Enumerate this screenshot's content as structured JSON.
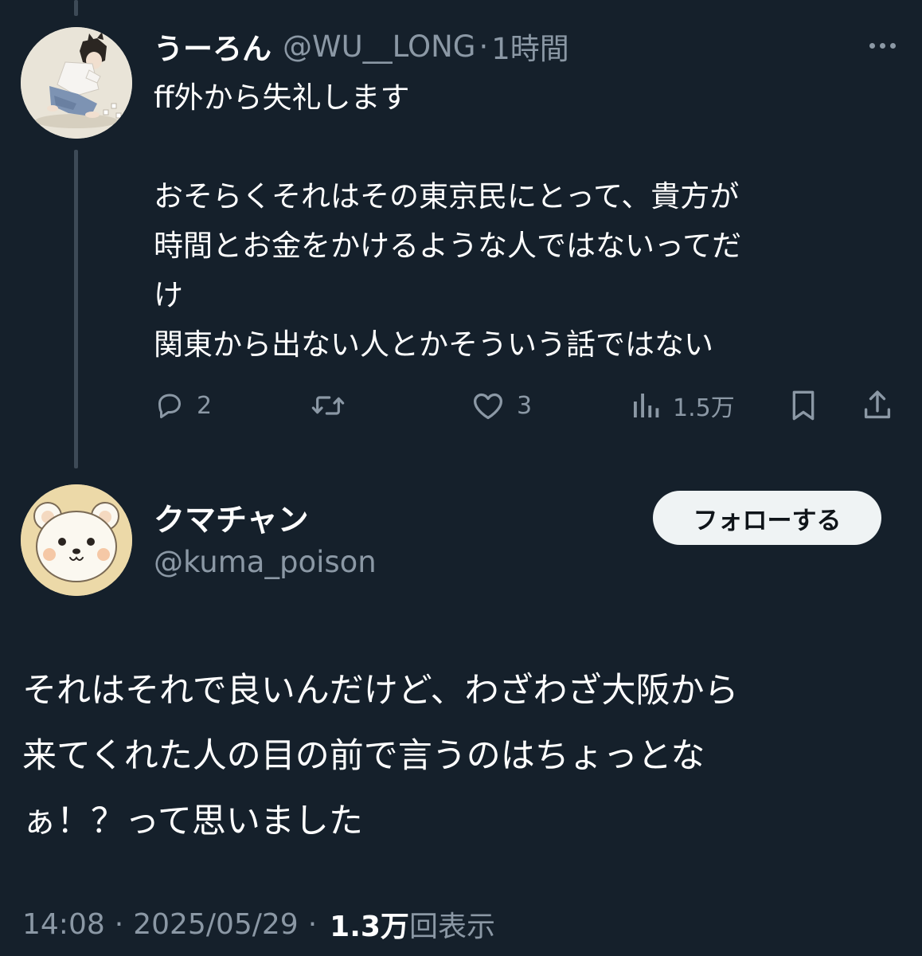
{
  "tweet1": {
    "display_name": "うーろん",
    "handle": "@WU__LONG",
    "separator": "·",
    "time": "1時間",
    "more_icon": "more-horizontal-icon",
    "lines": [
      "ff外から失礼します",
      "",
      "おそらくそれはその東京民にとって、貴方が",
      "時間とお金をかけるような人ではないってだ",
      "け",
      "関東から出ない人とかそういう話ではない"
    ],
    "actions": {
      "reply_count": "2",
      "retweet_count": "",
      "like_count": "3",
      "views_count": "1.5万"
    }
  },
  "tweet2": {
    "display_name": "クマチャン",
    "handle": "@kuma_poison",
    "follow_label": "フォローする",
    "lines": [
      "それはそれで良いんだけど、わざわざ大阪から",
      "来てくれた人の目の前で言うのはちょっとな",
      "ぁ！？って思いました"
    ],
    "time": "14:08",
    "separator": "·",
    "date": "2025/05/29",
    "views_count": "1.3万",
    "views_label": "回表示"
  },
  "colors": {
    "background": "#15202b",
    "text_primary": "#ffffff",
    "text_secondary": "#8b98a5",
    "follow_button_bg": "#eff3f4",
    "thread_line": "#3d4a57"
  }
}
